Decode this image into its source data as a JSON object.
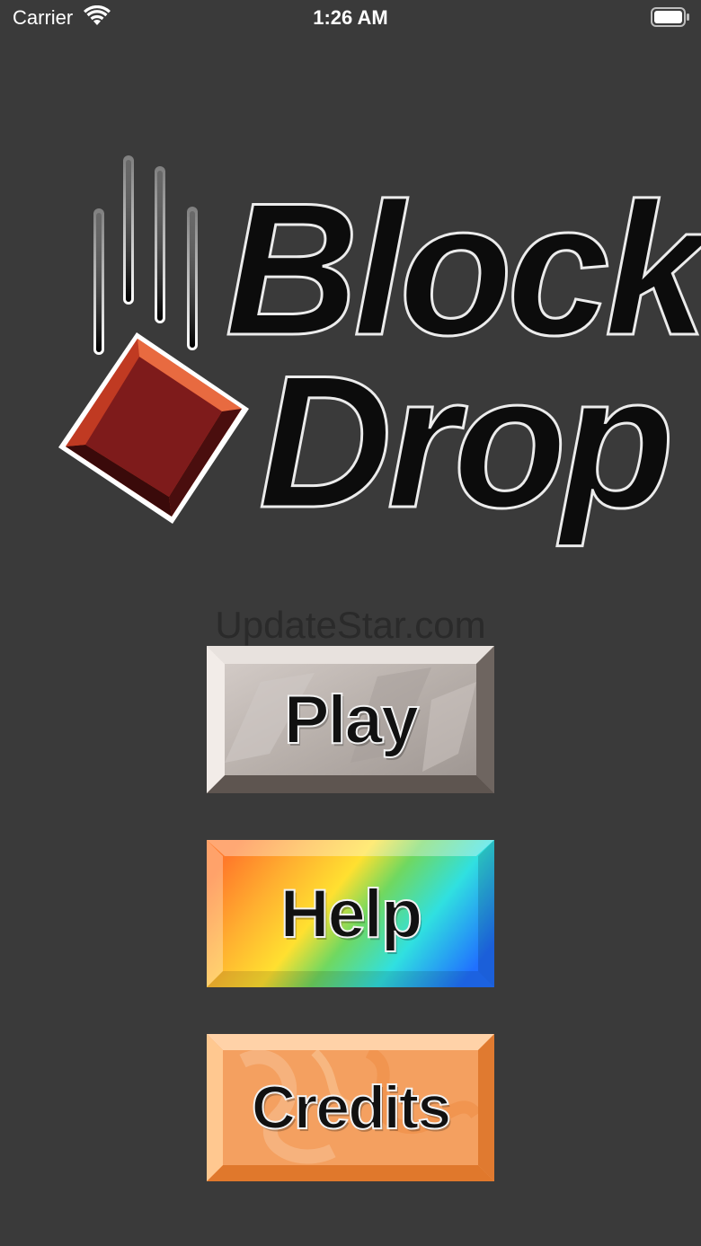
{
  "status_bar": {
    "carrier": "Carrier",
    "time": "1:26 AM"
  },
  "logo": {
    "line1": "Block",
    "line2": "Drop",
    "block_color": "#8b1e1e",
    "block_edge_color": "#d24a2a"
  },
  "watermark": "UpdateStar.com",
  "menu": {
    "play_label": "Play",
    "help_label": "Help",
    "credits_label": "Credits"
  },
  "colors": {
    "background": "#3a3a3a",
    "play_button": "#b8b0aa",
    "credits_button": "#f4a060"
  }
}
